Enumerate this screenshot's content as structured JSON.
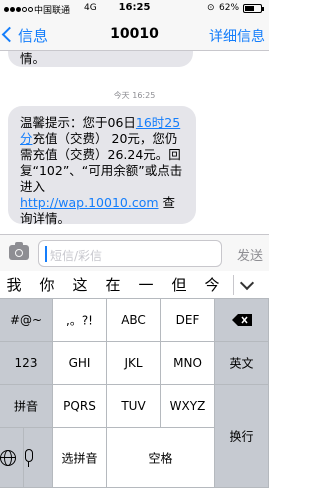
{
  "status_bar": {
    "carrier": "中国联通",
    "network": "4G",
    "time": "16:25",
    "battery_percent": "62%",
    "battery_level": 0.62,
    "signal_bars_filled": 3,
    "signal_bars_total": 5
  },
  "nav": {
    "back_label": "信息",
    "title": "10010",
    "detail_label": "详细信息"
  },
  "conversation": {
    "prev_message_tail": "情。",
    "timestamp": "今天 16:25",
    "message": {
      "part1": "温馨提示：您于06日",
      "link_time": "16时25分",
      "part2": "充值（交费） 20元，您仍需充值（交费）26.24元。回复“102”、“可用余额”或点击进入 ",
      "link_url": "http://wap.10010.com",
      "part3": " 查询详情。"
    }
  },
  "input_bar": {
    "placeholder": "短信/彩信",
    "send_label": "发送"
  },
  "keyboard": {
    "candidates": [
      "我",
      "你",
      "这",
      "在",
      "一",
      "但",
      "今"
    ],
    "row1": [
      "#@~",
      ",。?!",
      "ABC",
      "DEF"
    ],
    "row2": [
      "123",
      "GHI",
      "JKL",
      "MNO",
      "英文"
    ],
    "row3": [
      "拼音",
      "PQRS",
      "TUV",
      "WXYZ"
    ],
    "row4_select": "选拼音",
    "space": "空格",
    "newline": "换行"
  },
  "colors": {
    "accent": "#157efb",
    "bubble": "#e5e5ea"
  }
}
